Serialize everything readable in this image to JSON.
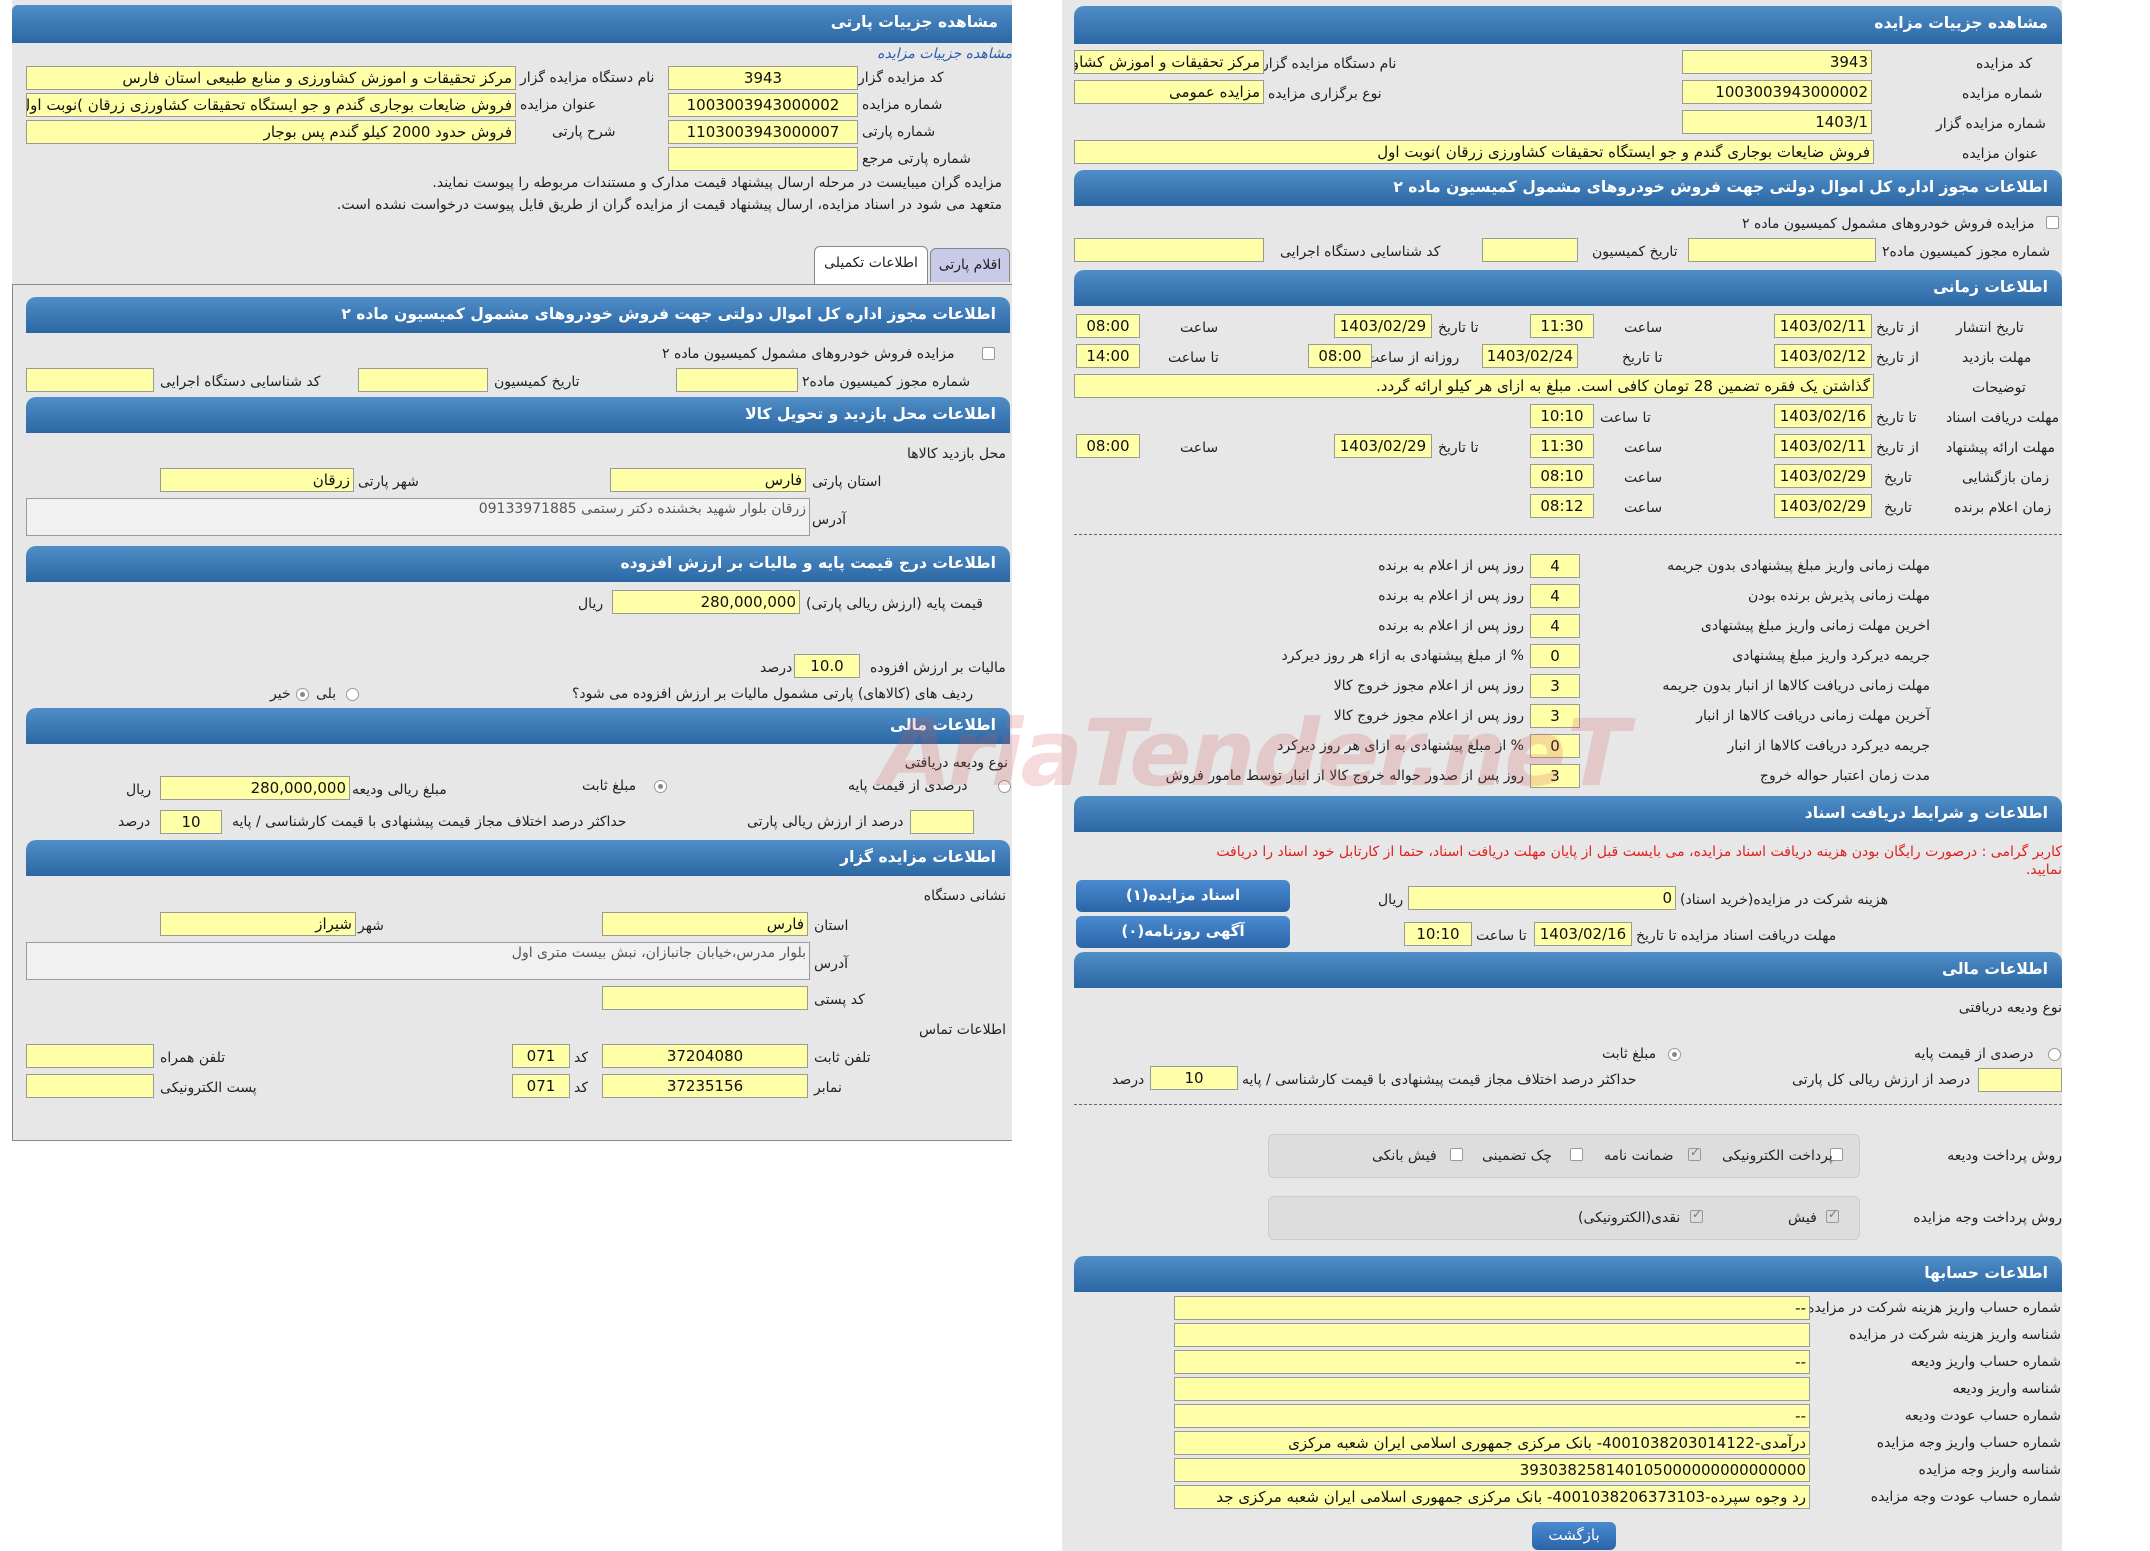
{
  "left": {
    "title": "مشاهده جزییات پارتی",
    "breadcrumb": "مشاهده جزییات مزایده",
    "labels": {
      "auction_code": "کد مزایده گزار",
      "org_name": "نام دستگاه مزایده گزار",
      "auction_no": "شماره مزایده",
      "auction_title": "عنوان مزایده",
      "party_no": "شماره پارتی",
      "party_desc": "شرح پارتی",
      "party_ref": "شماره پارتی مرجع"
    },
    "values": {
      "auction_code": "3943",
      "org_name": "مرکز تحقیقات و اموزش کشاورزی و منابع طبیعی استان فارس",
      "auction_no": "1003003943000002",
      "auction_title": "فروش ضایعات بوجاری گندم و جو ایستگاه تحقیقات کشاورزی زرقان )نوبت اول",
      "party_no": "1103003943000007",
      "party_desc": "فروش حدود 2000 کیلو گندم پس بوجار",
      "party_ref": ""
    },
    "notes": [
      "مزایده گران میبایست در مرحله ارسال پیشنهاد قیمت مدارک و مستندات مربوطه را پیوست نمایند.",
      "متعهد می شود در اسناد مزایده، ارسال پیشنهاد قیمت از مزایده گران از طریق فایل پیوست درخواست نشده است."
    ],
    "tabs": [
      "اقلام پارتی",
      "اطلاعات تکمیلی"
    ],
    "sec_license": "اطلاعات مجوز اداره کل اموال دولتی جهت فروش خودروهای مشمول کمیسیون ماده ۲",
    "license_chk": "مزایده فروش خودروهای مشمول کمیسیون ماده ۲",
    "license_labels": {
      "permit_no": "شماره مجوز کمیسیون ماده۲",
      "commission_date": "تاریخ کمیسیون",
      "exec_id": "کد شناسایی دستگاه اجرایی"
    },
    "sec_visit": "اطلاعات محل بازدید و تحویل کالا",
    "visit_place": "محل بازدید کالاها",
    "visit_labels": {
      "province": "استان پارتی",
      "city": "شهر پارتی",
      "address": "آدرس"
    },
    "visit_values": {
      "province": "فارس",
      "city": "زرقان",
      "address": "زرقان بلوار شهید بخشنده دکتر رستمی 09133971885"
    },
    "sec_price": "اطلاعات درج قیمت پایه و مالیات بر ارزش افزوده",
    "price_labels": {
      "base": "قیمت پایه (ارزش ریالی پارتی)",
      "rial": "ریال",
      "vat": "مالیات بر ارزش افزوده",
      "percent": "درصد",
      "vat_q": "ردیف های (کالاهای) پارتی مشمول مالیات بر ارزش افزوده می شود؟",
      "yes": "بلی",
      "no": "خیر"
    },
    "price_values": {
      "base": "280,000,000",
      "vat": "10.0"
    },
    "sec_fin": "اطلاعات مالی",
    "fin_labels": {
      "deposit_type": "نوع ودیعه دریافتی",
      "fixed": "مبلغ ثابت",
      "pct_base": "درصدی از قیمت پایه",
      "deposit_amt": "مبلغ ریالی ودیعه",
      "rial": "ریال",
      "pct_party": "درصد از ارزش ریالی پارتی",
      "max_diff": "حداکثر درصد اختلاف مجاز قیمت پیشنهادی با قیمت کارشناسی / پایه",
      "percent": "درصد"
    },
    "fin_values": {
      "deposit_amt": "280,000,000",
      "pct_party": "",
      "max_diff": "10"
    },
    "sec_org": "اطلاعات مزایده گزار",
    "org_labels": {
      "addr_title": "نشانی دستگاه",
      "province": "استان",
      "city": "شهر",
      "address": "آدرس",
      "postal": "کد پستی",
      "contact": "اطلاعات تماس",
      "phone": "تلفن ثابت",
      "code": "کد",
      "mobile": "تلفن همراه",
      "fax": "نمابر",
      "email": "پست الکترونیکی"
    },
    "org_values": {
      "province": "فارس",
      "city": "شیراز",
      "address": "بلوار مدرس،خیابان جانبازان، نبش بیست متری اول",
      "postal": "",
      "phone": "37204080",
      "phone_code": "071",
      "fax": "37235156",
      "fax_code": "071",
      "mobile": "",
      "email": ""
    }
  },
  "right": {
    "title": "مشاهده جزییات مزایده",
    "labels": {
      "auction_code": "کد مزایده",
      "org_name": "نام دستگاه مزایده گزار",
      "auction_no": "شماره مزایده",
      "holding_type": "نوع برگزاری مزایده",
      "auction_no2": "شماره مزایده گزار",
      "auction_title": "عنوان مزایده"
    },
    "values": {
      "auction_code": "3943",
      "org_name": "مرکز تحقیقات و اموزش کشاورزی",
      "auction_no": "1003003943000002",
      "holding_type": "مزایده عمومی",
      "auction_no2": "1403/1",
      "auction_title": "فروش ضایعات بوجاری گندم و جو ایستگاه تحقیقات کشاورزی زرقان )نوبت اول"
    },
    "sec_license": "اطلاعات مجوز اداره کل اموال دولتی جهت فروش خودروهای مشمول کمیسیون ماده ۲",
    "license_chk": "مزایده فروش خودروهای مشمول کمیسیون ماده ۲",
    "license_labels": {
      "permit_no": "شماره مجوز کمیسیون ماده۲",
      "commission_date": "تاریخ کمیسیون",
      "exec_id": "کد شناسایی دستگاه اجرایی"
    },
    "sec_time": "اطلاعات زمانی",
    "time_labels": {
      "publish": "تاریخ انتشار",
      "visit": "مهلت بازدید",
      "notes": "توضیحات",
      "doc_deadline": "مهلت دریافت اسناد",
      "offer_deadline": "مهلت ارائه پیشنهاد",
      "opening": "زمان بازگشایی",
      "winner": "زمان اعلام برنده",
      "from_date": "از تاریخ",
      "to_date": "تا تاریخ",
      "time": "ساعت",
      "to_time": "تا ساعت",
      "date": "تاریخ",
      "daily_from": "روزانه از ساعت"
    },
    "time_values": {
      "publish_from": "1403/02/11",
      "publish_from_time": "11:30",
      "publish_to": "1403/02/29",
      "publish_to_time": "08:00",
      "visit_from": "1403/02/12",
      "visit_to": "1403/02/24",
      "visit_daily_from": "08:00",
      "visit_daily_to": "14:00",
      "notes": "گذاشتن یک فقره تضمین 28 تومان کافی است. مبلغ به ازای هر کیلو ارائه گردد.",
      "doc_to": "1403/02/16",
      "doc_to_time": "10:10",
      "offer_from": "1403/02/11",
      "offer_from_time": "11:30",
      "offer_to": "1403/02/29",
      "offer_to_time": "08:00",
      "opening_date": "1403/02/29",
      "opening_time": "08:10",
      "winner_date": "1403/02/29",
      "winner_time": "08:12"
    },
    "deadlines": [
      {
        "label": "مهلت زمانی واریز مبلغ پیشنهادی بدون جریمه",
        "value": "4",
        "unit": "روز پس از اعلام به برنده"
      },
      {
        "label": "مهلت زمانی پذیرش برنده بودن",
        "value": "4",
        "unit": "روز پس از اعلام به برنده"
      },
      {
        "label": "اخرین مهلت زمانی واریز مبلغ پیشنهادی",
        "value": "4",
        "unit": "روز پس از اعلام به برنده"
      },
      {
        "label": "جریمه دیرکرد واریز مبلغ پیشنهادی",
        "value": "0",
        "unit": "% از مبلغ پیشنهادی به ازاء هر روز دیرکرد"
      },
      {
        "label": "مهلت زمانی دریافت کالاها از انبار بدون جریمه",
        "value": "3",
        "unit": "روز پس از اعلام مجوز خروج کالا"
      },
      {
        "label": "آخرین مهلت زمانی دریافت کالاها از انبار",
        "value": "3",
        "unit": "روز پس از اعلام مجوز خروج کالا"
      },
      {
        "label": "جریمه دیرکرد دریافت کالاها از انبار",
        "value": "0",
        "unit": "% از مبلغ پیشنهادی به ازای هر روز دیرکرد"
      },
      {
        "label": "مدت زمان اعتبار حواله خروج",
        "value": "3",
        "unit": "روز پس از صدور حواله خروج کالا از انبار توسط مامور فروش"
      }
    ],
    "sec_docs": "اطلاعات و شرایط دریافت اسناد",
    "docs_warning_1": "کاربر گرامی : درصورت رایگان بودن هزینه دریافت اسناد مزایده، می بایست قبل از پایان مهلت دریافت اسناد، حتما از کارتابل خود اسناد را دریافت",
    "docs_warning_2": "نمایید.",
    "docs_labels": {
      "fee": "هزینه شرکت در مزایده(خرید اسناد)",
      "rial": "ریال",
      "deadline": "مهلت دریافت اسناد مزایده تا تاریخ",
      "to_time": "تا ساعت"
    },
    "docs_values": {
      "fee": "0",
      "deadline_date": "1403/02/16",
      "deadline_time": "10:10"
    },
    "docs_buttons": {
      "docs": "اسناد مزایده(۱)",
      "ads": "آگهی روزنامه(۰)"
    },
    "sec_fin": "اطلاعات مالی",
    "fin_labels": {
      "deposit_type": "نوع ودیعه دریافتی",
      "pct_base": "درصدی از قیمت پایه",
      "fixed": "مبلغ ثابت",
      "pct_total": "درصد از ارزش ریالی کل پارتی",
      "max_diff": "حداکثر درصد اختلاف مجاز قیمت پیشنهادی با قیمت کارشناسی / پایه",
      "percent": "درصد",
      "deposit_method": "روش پرداخت ودیعه",
      "payment_method": "روش پرداخت وجه مزایده"
    },
    "fin_values": {
      "pct_total": "",
      "max_diff": "10"
    },
    "deposit_methods": [
      "پرداخت الکترونیکی",
      "ضمانت نامه",
      "چک تضمینی",
      "فیش بانکی"
    ],
    "payment_methods": [
      "فیش",
      "نقدی(الکترونیکی)"
    ],
    "sec_accounts": "اطلاعات حسابها",
    "accounts": [
      {
        "label": "شماره حساب واریز هزینه شرکت در مزایده",
        "value": "--"
      },
      {
        "label": "شناسه واریز هزینه شرکت در مزایده",
        "value": ""
      },
      {
        "label": "شماره حساب واریز ودیعه",
        "value": "--"
      },
      {
        "label": "شناسه واریز ودیعه",
        "value": ""
      },
      {
        "label": "شماره حساب عودت ودیعه",
        "value": "--"
      },
      {
        "label": "شماره حساب واریز وجه مزایده",
        "value": "درآمدی-4001038203014122- بانک مرکزی جمهوری اسلامی ایران شعبه مرکزی"
      },
      {
        "label": "شناسه واریز وجه مزایده",
        "value": "393038258140105000000000000000"
      },
      {
        "label": "شماره حساب عودت وجه مزایده",
        "value": "رد وجوه سپرده-4001038206373103- بانک مرکزی جمهوری اسلامی ایران شعبه مرکزی جد"
      }
    ],
    "back_button": "بازگشت"
  },
  "watermark": "AriaTender.neT",
  "colors": {
    "header": "#2c67a4",
    "field": "#ffffa8",
    "panel": "#e7e7e7",
    "warning": "#e02020"
  }
}
